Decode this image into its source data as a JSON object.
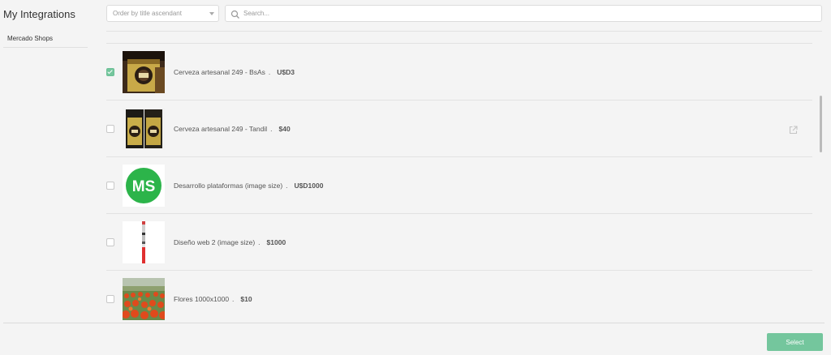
{
  "sidebar": {
    "title": "My Integrations",
    "items": [
      {
        "label": "Mercado Shops"
      }
    ]
  },
  "toolbar": {
    "order_select_value": "Order by title ascendant",
    "search_placeholder": "Search..."
  },
  "products": [
    {
      "name": "Cerveza artesanal 249 - BsAs",
      "separator": ".",
      "price": "U$D3",
      "checked": true,
      "thumbnail_icon": "beer-bottle-image"
    },
    {
      "name": "Cerveza artesanal 249 - Tandil",
      "separator": ".",
      "price": "$40",
      "checked": false,
      "thumbnail_icon": "beer-bottles-image",
      "has_external_link": true
    },
    {
      "name": "Desarrollo plataformas (image size)",
      "separator": ".",
      "price": "U$D1000",
      "checked": false,
      "thumbnail_icon": "ms-logo-image",
      "thumbnail_text": "MS"
    },
    {
      "name": "Diseño web 2 (image size)",
      "separator": ".",
      "price": "$1000",
      "checked": false,
      "thumbnail_icon": "vertical-strip-image"
    },
    {
      "name": "Flores 1000x1000",
      "separator": ".",
      "price": "$10",
      "checked": false,
      "thumbnail_icon": "tulip-field-image"
    }
  ],
  "footer": {
    "select_label": "Select"
  },
  "colors": {
    "accent": "#74c69d",
    "ms_logo": "#2cb44a"
  }
}
